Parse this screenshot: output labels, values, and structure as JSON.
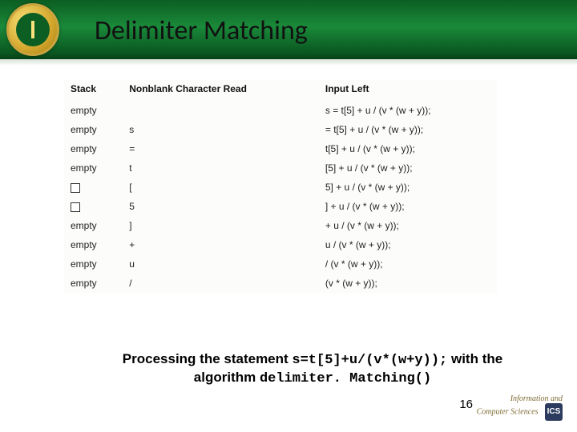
{
  "title": "Delimiter Matching",
  "columns": [
    "Stack",
    "Nonblank Character Read",
    "Input Left"
  ],
  "rows": [
    {
      "stack": "empty",
      "read": "",
      "input": "s = t[5] + u / (v * (w + y));"
    },
    {
      "stack": "empty",
      "read": "s",
      "input": "= t[5] + u / (v * (w + y));"
    },
    {
      "stack": "empty",
      "read": "=",
      "input": "t[5] + u / (v * (w + y));"
    },
    {
      "stack": "empty",
      "read": "t",
      "input": "[5] + u / (v * (w + y));"
    },
    {
      "stack": "[box]",
      "read": "[",
      "input": "5] + u / (v * (w + y));"
    },
    {
      "stack": "[box]",
      "read": "5",
      "input": "] + u / (v * (w + y));"
    },
    {
      "stack": "empty",
      "read": "]",
      "input": "+ u / (v * (w + y));"
    },
    {
      "stack": "empty",
      "read": "+",
      "input": "u / (v * (w + y));"
    },
    {
      "stack": "empty",
      "read": "u",
      "input": "/ (v * (w + y));"
    },
    {
      "stack": "empty",
      "read": "/",
      "input": "(v * (w + y));"
    }
  ],
  "caption_prefix": "Processing the statement ",
  "caption_code": "s=t[5]+u/(v*(w+y));",
  "caption_mid": " with the algorithm ",
  "caption_alg": "delimiter. Matching()",
  "page_number": "16",
  "footer_line1": "Information and",
  "footer_line2": "Computer Sciences",
  "footer_badge": "ICS"
}
